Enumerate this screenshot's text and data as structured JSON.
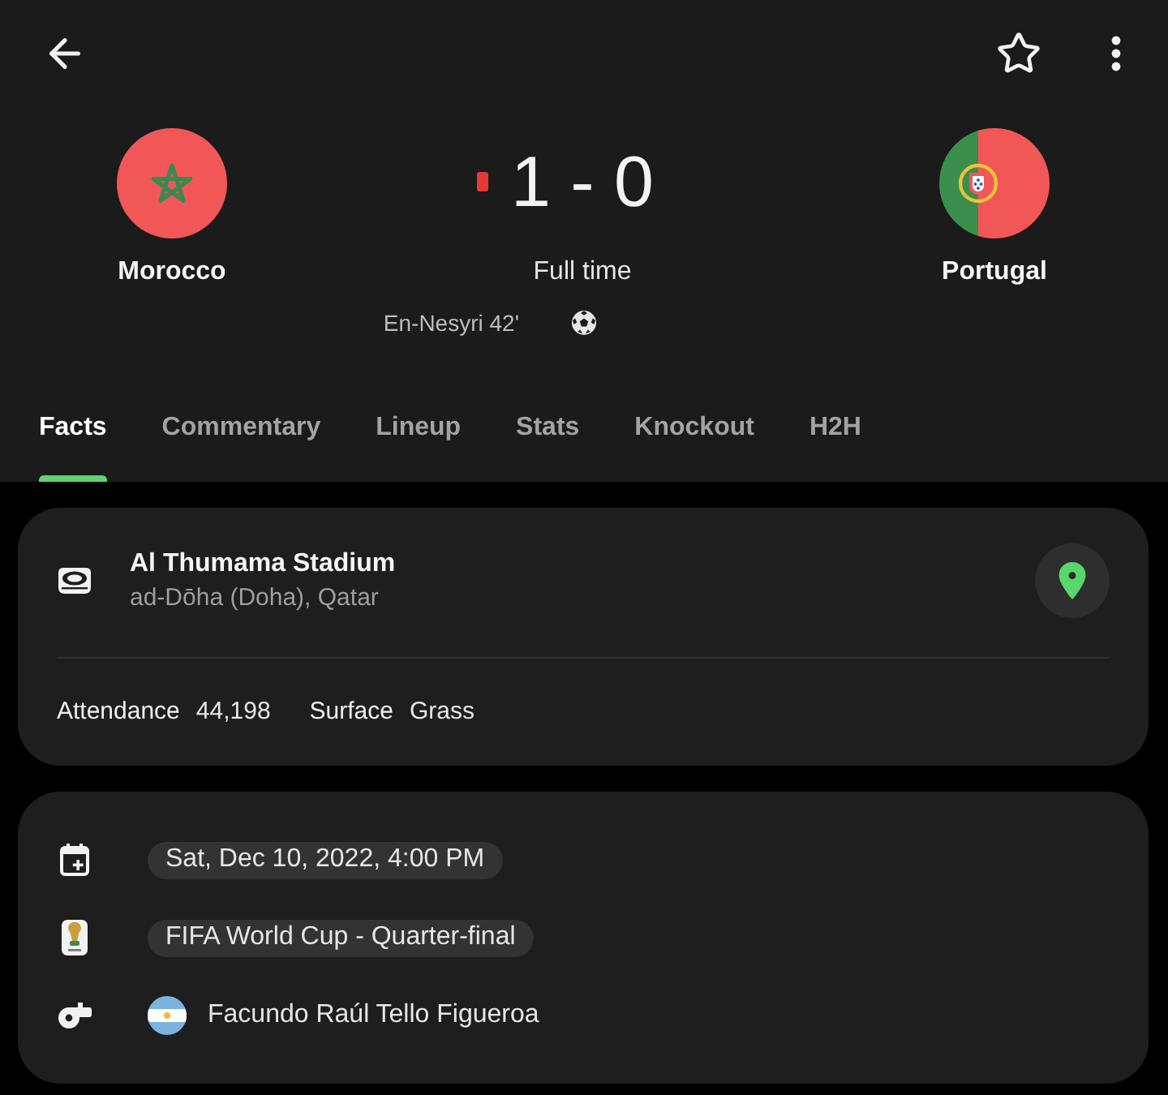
{
  "match": {
    "home": {
      "name": "Morocco",
      "flag": {
        "kind": "morocco"
      },
      "red_card": true,
      "goals": [
        "En-Nesyri 42'"
      ]
    },
    "away": {
      "name": "Portugal",
      "flag": {
        "kind": "portugal"
      }
    },
    "score": "1 - 0",
    "status": "Full time"
  },
  "tabs": [
    {
      "label": "Facts",
      "selected": true
    },
    {
      "label": "Commentary",
      "selected": false
    },
    {
      "label": "Lineup",
      "selected": false
    },
    {
      "label": "Stats",
      "selected": false
    },
    {
      "label": "Knockout",
      "selected": false
    },
    {
      "label": "H2H",
      "selected": false
    }
  ],
  "venue": {
    "name": "Al Thumama Stadium",
    "location": "ad-Dōha (Doha), Qatar",
    "details": [
      {
        "label": "Attendance",
        "value": "44,198"
      },
      {
        "label": "Surface",
        "value": "Grass"
      }
    ]
  },
  "info": [
    {
      "kind": "date",
      "text": "Sat, Dec 10, 2022, 4:00 PM"
    },
    {
      "kind": "tournament",
      "text": "FIFA World Cup - Quarter-final"
    },
    {
      "kind": "referee",
      "text": "Facundo Raúl Tello Figueroa",
      "flag": {
        "kind": "argentina"
      }
    }
  ]
}
